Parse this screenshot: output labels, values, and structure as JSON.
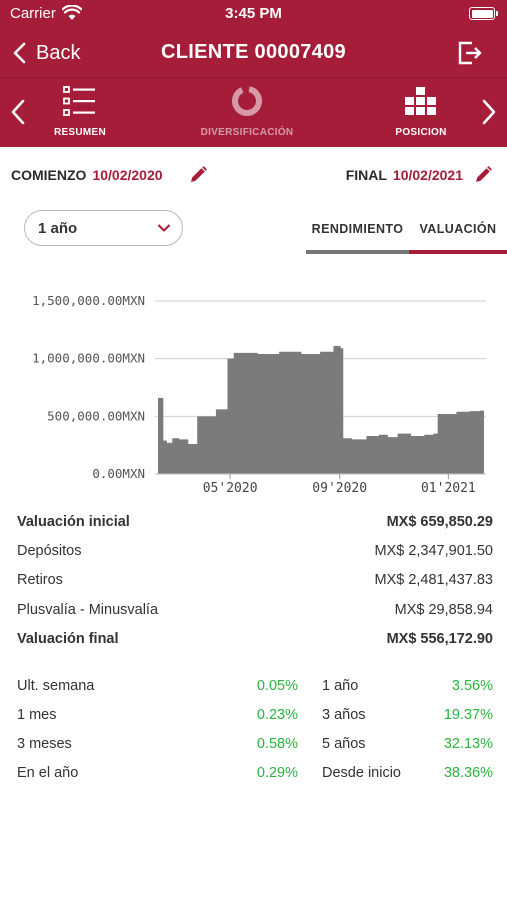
{
  "status_bar": {
    "carrier": "Carrier",
    "time": "3:45 PM"
  },
  "nav": {
    "back_label": "Back",
    "title": "CLIENTE 00007409"
  },
  "tabs": [
    {
      "label": "RESUMEN",
      "icon": "list-icon"
    },
    {
      "label": "DIVERSIFICACIÓN",
      "icon": "donut-icon"
    },
    {
      "label": "POSICION",
      "icon": "blocks-icon"
    }
  ],
  "dates": {
    "start_label": "COMIENZO",
    "start_value": "10/02/2020",
    "end_label": "FINAL",
    "end_value": "10/02/2021"
  },
  "period_select": {
    "selected": "1 año"
  },
  "segments": {
    "rendimiento": "RENDIMIENTO",
    "valuacion": "VALUACIÓN",
    "active": "valuacion"
  },
  "colors": {
    "brand": "#a51d38",
    "area": "#7a7b7a",
    "positive": "#2bb33f"
  },
  "chart_data": {
    "type": "area",
    "title": "",
    "xlabel": "",
    "ylabel": "",
    "y_ticks": [
      "1,500,000.00MXN",
      "1,000,000.00MXN",
      "500,000.00MXN",
      "0.00MXN"
    ],
    "x_ticks": [
      "05'2020",
      "09'2020",
      "01'2021"
    ],
    "ylim": [
      0,
      1500000
    ],
    "x": [
      "2020-02-10",
      "2020-02-16",
      "2020-02-20",
      "2020-02-26",
      "2020-03-05",
      "2020-03-15",
      "2020-03-25",
      "2020-04-01",
      "2020-04-15",
      "2020-04-25",
      "2020-04-28",
      "2020-05-05",
      "2020-05-20",
      "2020-06-01",
      "2020-06-15",
      "2020-06-25",
      "2020-07-10",
      "2020-07-20",
      "2020-08-10",
      "2020-08-25",
      "2020-09-02",
      "2020-09-05",
      "2020-09-15",
      "2020-10-01",
      "2020-10-15",
      "2020-10-25",
      "2020-11-05",
      "2020-11-20",
      "2020-12-05",
      "2020-12-15",
      "2020-12-20",
      "2021-01-10",
      "2021-01-25",
      "2021-02-05",
      "2021-02-10"
    ],
    "values": [
      660000,
      290000,
      270000,
      310000,
      300000,
      260000,
      500000,
      500000,
      560000,
      560000,
      1000000,
      1050000,
      1050000,
      1040000,
      1040000,
      1060000,
      1060000,
      1040000,
      1060000,
      1110000,
      1090000,
      310000,
      300000,
      330000,
      340000,
      320000,
      350000,
      330000,
      340000,
      350000,
      520000,
      540000,
      545000,
      550000,
      530000
    ]
  },
  "summary": [
    {
      "label": "Valuación inicial",
      "value": "MX$ 659,850.29",
      "bold": true
    },
    {
      "label": "Depósitos",
      "value": "MX$ 2,347,901.50",
      "bold": false
    },
    {
      "label": "Retiros",
      "value": "MX$ 2,481,437.83",
      "bold": false
    },
    {
      "label": "Plusvalía - Minusvalía",
      "value": "MX$ 29,858.94",
      "bold": false
    },
    {
      "label": "Valuación final",
      "value": "MX$ 556,172.90",
      "bold": true
    }
  ],
  "returns": [
    {
      "label1": "Ult. semana",
      "value1": "0.05%",
      "label2": "1 año",
      "value2": "3.56%"
    },
    {
      "label1": "1 mes",
      "value1": "0.23%",
      "label2": "3 años",
      "value2": "19.37%"
    },
    {
      "label1": "3 meses",
      "value1": "0.58%",
      "label2": "5 años",
      "value2": "32.13%"
    },
    {
      "label1": "En el año",
      "value1": "0.29%",
      "label2": "Desde inicio",
      "value2": "38.36%"
    }
  ]
}
